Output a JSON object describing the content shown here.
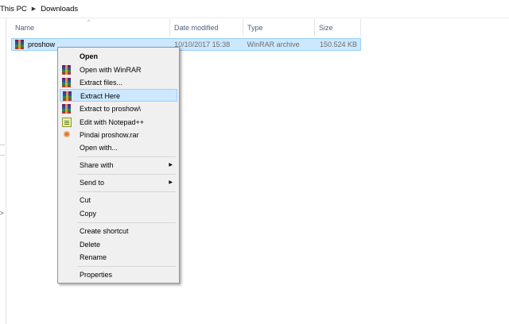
{
  "breadcrumb": {
    "items": [
      "This PC",
      "Downloads"
    ],
    "separator": "▶"
  },
  "columns": {
    "name": "Name",
    "date": "Date modified",
    "type": "Type",
    "size": "Size",
    "sort_arrow": "^"
  },
  "file": {
    "name": "proshow",
    "date": "10/10/2017 15:38",
    "type": "WinRAR archive",
    "size": "150.524 KB",
    "icon": "winrar-archive-icon"
  },
  "menu": {
    "items": [
      {
        "label": "Open",
        "bold": true
      },
      {
        "label": "Open with WinRAR",
        "icon": "winrar-icon"
      },
      {
        "label": "Extract files...",
        "icon": "winrar-icon"
      },
      {
        "label": "Extract Here",
        "icon": "winrar-icon",
        "hover": true
      },
      {
        "label": "Extract to proshow\\",
        "icon": "winrar-icon"
      },
      {
        "label": "Edit with Notepad++",
        "icon": "notepad-plus-icon"
      },
      {
        "label": "Pindai proshow.rar",
        "icon": "avast-scan-icon"
      },
      {
        "label": "Open with..."
      },
      {
        "label": "Share with",
        "submenu": true
      },
      {
        "label": "Send to",
        "submenu": true
      },
      {
        "label": "Cut"
      },
      {
        "label": "Copy"
      },
      {
        "label": "Create shortcut"
      },
      {
        "label": "Delete"
      },
      {
        "label": "Rename"
      },
      {
        "label": "Properties"
      }
    ],
    "submenu_arrow": "▶"
  },
  "colors": {
    "selection": "#cce8ff",
    "selection_border": "#99d1ff",
    "header_text": "#4c607a"
  }
}
